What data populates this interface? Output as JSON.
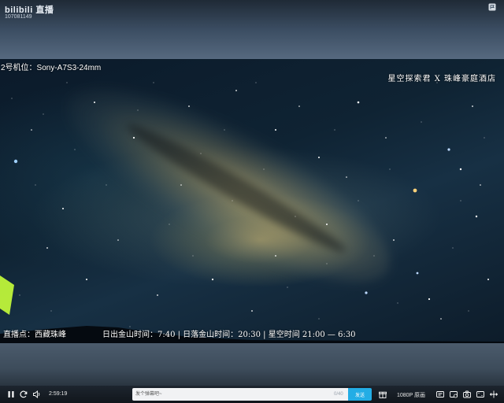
{
  "header": {
    "logo_text": "bilibili 直播",
    "room_id": "107081149"
  },
  "video": {
    "camera_label": "2号机位：Sony-A7S3-24mm",
    "brand_label": "星空探索君 X 珠峰豪庭酒店",
    "location_label": "直播点：西藏珠峰",
    "times_label": "日出金山时间：7:40  |  日落金山时间：20:30  |  星空时间  21:00 — 6:30"
  },
  "controls": {
    "elapsed_time": "2:59:19",
    "danmaku_placeholder": "发个弹幕吧~",
    "char_count": "0/40",
    "send_label": "发送",
    "quality_label": "1080P 原画"
  },
  "colors": {
    "send_button": "#23ade5",
    "control_bar": "#11161c"
  },
  "icons": [
    "flag-icon",
    "pause-icon",
    "refresh-icon",
    "volume-icon",
    "gift-icon",
    "danmaku-settings-icon",
    "danmaku-toggle-icon",
    "screenshot-icon",
    "pip-icon",
    "fullscreen-icon"
  ]
}
